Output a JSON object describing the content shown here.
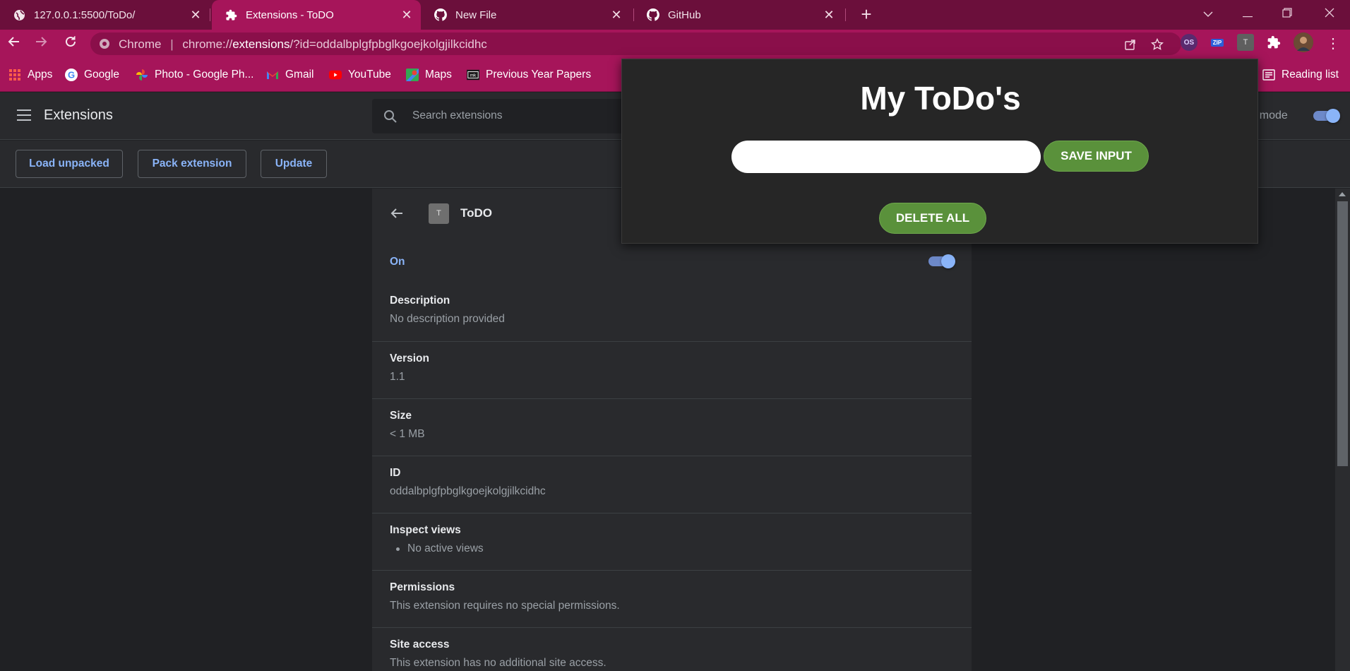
{
  "browser": {
    "tabs": [
      {
        "title": "127.0.0.1:5500/ToDo/",
        "icon": "globe-icon",
        "active": false
      },
      {
        "title": "Extensions - ToDO",
        "icon": "puzzle-icon",
        "active": true
      },
      {
        "title": "New File",
        "icon": "github-icon",
        "active": false
      },
      {
        "title": "GitHub",
        "icon": "github-icon",
        "active": false
      }
    ],
    "address": {
      "scheme_label": "Chrome",
      "separator": "|",
      "url_prefix": "chrome://",
      "url_host": "extensions",
      "url_rest": "/?id=oddalbplgfpbglkgoejkolgjilkcidhc"
    },
    "ext_icons": [
      "os-extension-icon",
      "zip-extension-icon",
      "todo-extension-icon",
      "extensions-puzzle-icon",
      "profile-avatar"
    ],
    "ext_zip_label": "ZIP",
    "ext_todo_label": "T",
    "bookmarks": [
      {
        "label": "Apps",
        "icon": "apps-grid-icon"
      },
      {
        "label": "Google",
        "icon": "google-icon"
      },
      {
        "label": "Photo - Google Ph...",
        "icon": "google-photos-icon"
      },
      {
        "label": "Gmail",
        "icon": "gmail-icon"
      },
      {
        "label": "YouTube",
        "icon": "youtube-icon"
      },
      {
        "label": "Maps",
        "icon": "maps-icon"
      },
      {
        "label": "Previous Year Papers",
        "icon": "papers-icon"
      }
    ],
    "reading_list": "Reading list"
  },
  "extensions_page": {
    "title": "Extensions",
    "search_placeholder": "Search extensions",
    "dev_mode_label_visible": "r mode",
    "dev_mode_on": true,
    "actions": [
      "Load unpacked",
      "Pack extension",
      "Update"
    ]
  },
  "detail": {
    "name": "ToDO",
    "logo_letter": "T",
    "status_label": "On",
    "enabled": true,
    "sections": [
      {
        "title": "Description",
        "value": "No description provided"
      },
      {
        "title": "Version",
        "value": "1.1"
      },
      {
        "title": "Size",
        "value": "< 1 MB"
      },
      {
        "title": "ID",
        "value": "oddalbplgfpbglkgoejkolgjilkcidhc"
      },
      {
        "title": "Inspect views",
        "value": "No active views"
      },
      {
        "title": "Permissions",
        "value": "This extension requires no special permissions."
      },
      {
        "title": "Site access",
        "value": "This extension has no additional site access."
      }
    ]
  },
  "popup": {
    "title": "My ToDo's",
    "input_value": "",
    "save_label": "SAVE INPUT",
    "delete_label": "DELETE ALL",
    "button_color": "#5a913b"
  },
  "colors": {
    "frame": "#6b0f3b",
    "toolbar": "#a6155a",
    "accent_blue": "#8ab4f8",
    "page_bg": "#202124",
    "card_bg": "#292a2d"
  }
}
